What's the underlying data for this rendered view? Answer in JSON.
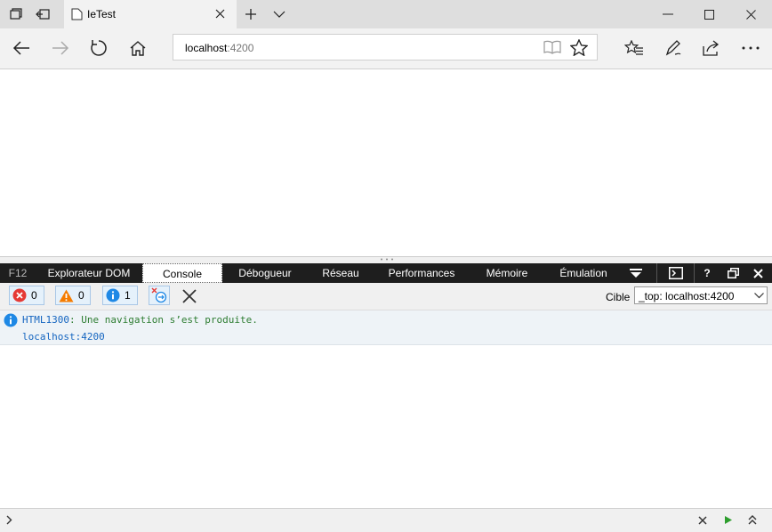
{
  "browser": {
    "tab_title": "IeTest",
    "address_host": "localhost",
    "address_port": ":4200"
  },
  "devtools": {
    "f12_label": "F12",
    "tabs": [
      "Explorateur DOM",
      "Console",
      "Débogueur",
      "Réseau",
      "Performances",
      "Mémoire",
      "Émulation"
    ],
    "active_tab": "Console",
    "help_label": "?",
    "filters": {
      "errors": "0",
      "warnings": "0",
      "info": "1"
    },
    "target_label": "Cible",
    "target_value": "_top: localhost:4200",
    "messages": [
      {
        "code": "HTML1300",
        "text": ": Une navigation s’est produite.",
        "source": "localhost:4200"
      }
    ]
  },
  "colors": {
    "f12_bar": "#1e1e1e",
    "info_blue": "#1e88e5",
    "error_red": "#e53935",
    "warning_orange": "#f57c00"
  }
}
